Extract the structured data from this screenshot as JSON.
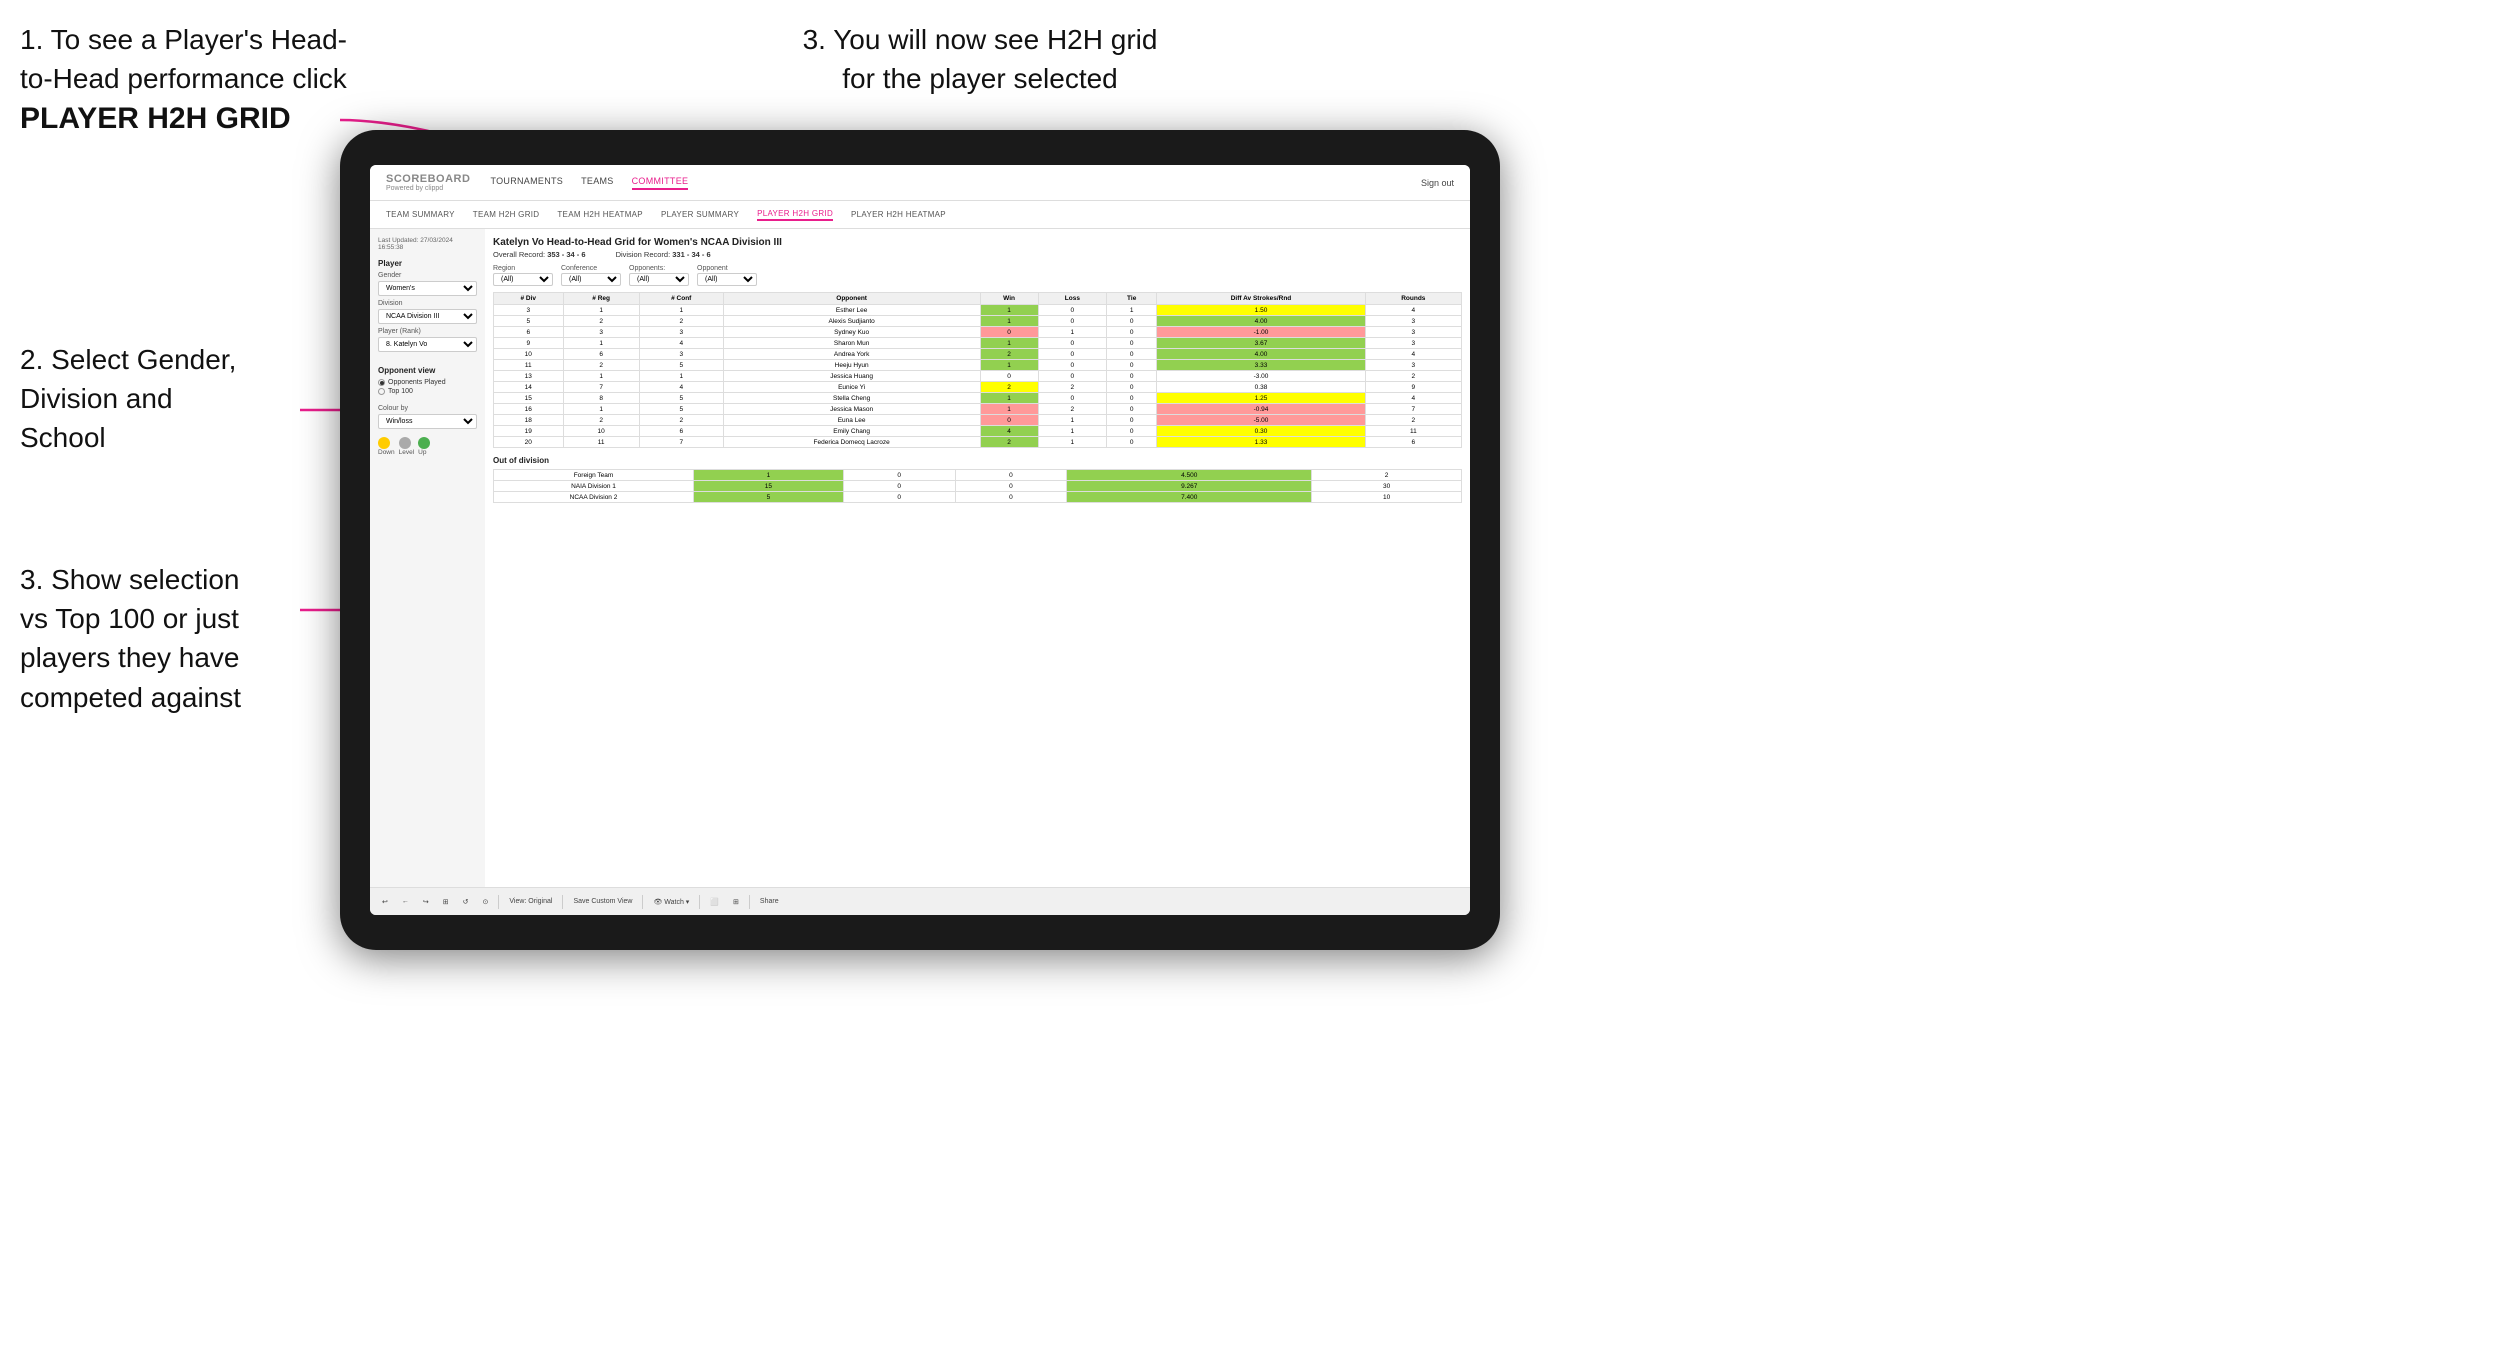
{
  "instructions": {
    "top_left_line1": "1. To see a Player's Head-",
    "top_left_line2": "to-Head performance click",
    "top_left_bold": "PLAYER H2H GRID",
    "top_right": "3. You will now see H2H grid\nfor the player selected",
    "mid_left_title": "2. Select Gender,\nDivision and\nSchool",
    "bottom_left": "3. Show selection\nvs Top 100 or just\nplayers they have\ncompeted against"
  },
  "nav": {
    "logo": "SCOREBOARD",
    "logo_sub": "Powered by clippd",
    "items": [
      "TOURNAMENTS",
      "TEAMS",
      "COMMITTEE"
    ],
    "active_main": "COMMITTEE",
    "sign_out": "Sign out",
    "sub_items": [
      "TEAM SUMMARY",
      "TEAM H2H GRID",
      "TEAM H2H HEATMAP",
      "PLAYER SUMMARY",
      "PLAYER H2H GRID",
      "PLAYER H2H HEATMAP"
    ],
    "active_sub": "PLAYER H2H GRID"
  },
  "sidebar": {
    "timestamp": "Last Updated: 27/03/2024\n16:55:38",
    "player_section": "Player",
    "gender_label": "Gender",
    "gender_value": "Women's",
    "division_label": "Division",
    "division_value": "NCAA Division III",
    "player_rank_label": "Player (Rank)",
    "player_rank_value": "8. Katelyn Vo",
    "opponent_view_label": "Opponent view",
    "radio_opponents": "Opponents Played",
    "radio_top100": "Top 100",
    "colour_by_label": "Colour by",
    "colour_by_value": "Win/loss",
    "legend_down": "Down",
    "legend_level": "Level",
    "legend_up": "Up"
  },
  "grid": {
    "title": "Katelyn Vo Head-to-Head Grid for Women's NCAA Division III",
    "overall_record_label": "Overall Record:",
    "overall_record": "353 - 34 - 6",
    "division_record_label": "Division Record:",
    "division_record": "331 - 34 - 6",
    "filters": {
      "region_label": "Region",
      "region_value": "(All)",
      "conference_label": "Conference",
      "conference_value": "(All)",
      "opponent_label": "Opponent",
      "opponent_value": "(All)",
      "opponents_label": "Opponents:"
    },
    "table_headers": [
      "# Div",
      "# Reg",
      "# Conf",
      "Opponent",
      "Win",
      "Loss",
      "Tie",
      "Diff Av Strokes/Rnd",
      "Rounds"
    ],
    "rows": [
      {
        "div": "3",
        "reg": "1",
        "conf": "1",
        "opponent": "Esther Lee",
        "win": "1",
        "loss": "0",
        "tie": "1",
        "diff": "1.50",
        "rounds": "4",
        "win_color": "yellow",
        "loss_color": "neutral"
      },
      {
        "div": "5",
        "reg": "2",
        "conf": "2",
        "opponent": "Alexis Sudjianto",
        "win": "1",
        "loss": "0",
        "tie": "0",
        "diff": "4.00",
        "rounds": "3",
        "win_color": "green",
        "loss_color": "neutral"
      },
      {
        "div": "6",
        "reg": "3",
        "conf": "3",
        "opponent": "Sydney Kuo",
        "win": "0",
        "loss": "1",
        "tie": "0",
        "diff": "-1.00",
        "rounds": "3",
        "win_color": "neutral",
        "loss_color": "red"
      },
      {
        "div": "9",
        "reg": "1",
        "conf": "4",
        "opponent": "Sharon Mun",
        "win": "1",
        "loss": "0",
        "tie": "0",
        "diff": "3.67",
        "rounds": "3",
        "win_color": "green",
        "loss_color": "neutral"
      },
      {
        "div": "10",
        "reg": "6",
        "conf": "3",
        "opponent": "Andrea York",
        "win": "2",
        "loss": "0",
        "tie": "0",
        "diff": "4.00",
        "rounds": "4",
        "win_color": "green",
        "loss_color": "neutral"
      },
      {
        "div": "11",
        "reg": "2",
        "conf": "5",
        "opponent": "Heeju Hyun",
        "win": "1",
        "loss": "0",
        "tie": "0",
        "diff": "3.33",
        "rounds": "3",
        "win_color": "green",
        "loss_color": "neutral"
      },
      {
        "div": "13",
        "reg": "1",
        "conf": "1",
        "opponent": "Jessica Huang",
        "win": "0",
        "loss": "0",
        "tie": "0",
        "diff": "-3.00",
        "rounds": "2",
        "win_color": "neutral",
        "loss_color": "neutral"
      },
      {
        "div": "14",
        "reg": "7",
        "conf": "4",
        "opponent": "Eunice Yi",
        "win": "2",
        "loss": "2",
        "tie": "0",
        "diff": "0.38",
        "rounds": "9",
        "win_color": "yellow",
        "loss_color": "neutral"
      },
      {
        "div": "15",
        "reg": "8",
        "conf": "5",
        "opponent": "Stella Cheng",
        "win": "1",
        "loss": "0",
        "tie": "0",
        "diff": "1.25",
        "rounds": "4",
        "win_color": "green",
        "loss_color": "neutral"
      },
      {
        "div": "16",
        "reg": "1",
        "conf": "5",
        "opponent": "Jessica Mason",
        "win": "1",
        "loss": "2",
        "tie": "0",
        "diff": "-0.94",
        "rounds": "7",
        "win_color": "neutral",
        "loss_color": "red"
      },
      {
        "div": "18",
        "reg": "2",
        "conf": "2",
        "opponent": "Euna Lee",
        "win": "0",
        "loss": "1",
        "tie": "0",
        "diff": "-5.00",
        "rounds": "2",
        "win_color": "neutral",
        "loss_color": "red"
      },
      {
        "div": "19",
        "reg": "10",
        "conf": "6",
        "opponent": "Emily Chang",
        "win": "4",
        "loss": "1",
        "tie": "0",
        "diff": "0.30",
        "rounds": "11",
        "win_color": "yellow",
        "loss_color": "neutral"
      },
      {
        "div": "20",
        "reg": "11",
        "conf": "7",
        "opponent": "Federica Domecq Lacroze",
        "win": "2",
        "loss": "1",
        "tie": "0",
        "diff": "1.33",
        "rounds": "6",
        "win_color": "green",
        "loss_color": "neutral"
      }
    ],
    "out_of_division_title": "Out of division",
    "out_rows": [
      {
        "label": "Foreign Team",
        "win": "1",
        "loss": "0",
        "tie": "0",
        "diff": "4.500",
        "rounds": "2"
      },
      {
        "label": "NAIA Division 1",
        "win": "15",
        "loss": "0",
        "tie": "0",
        "diff": "9.267",
        "rounds": "30"
      },
      {
        "label": "NCAA Division 2",
        "win": "5",
        "loss": "0",
        "tie": "0",
        "diff": "7.400",
        "rounds": "10"
      }
    ]
  },
  "toolbar": {
    "buttons": [
      "↩",
      "←",
      "↪",
      "⊞",
      "↺",
      "⊙",
      "View: Original",
      "Save Custom View",
      "👁 Watch ▾",
      "⬜",
      "⊞",
      "Share"
    ]
  }
}
